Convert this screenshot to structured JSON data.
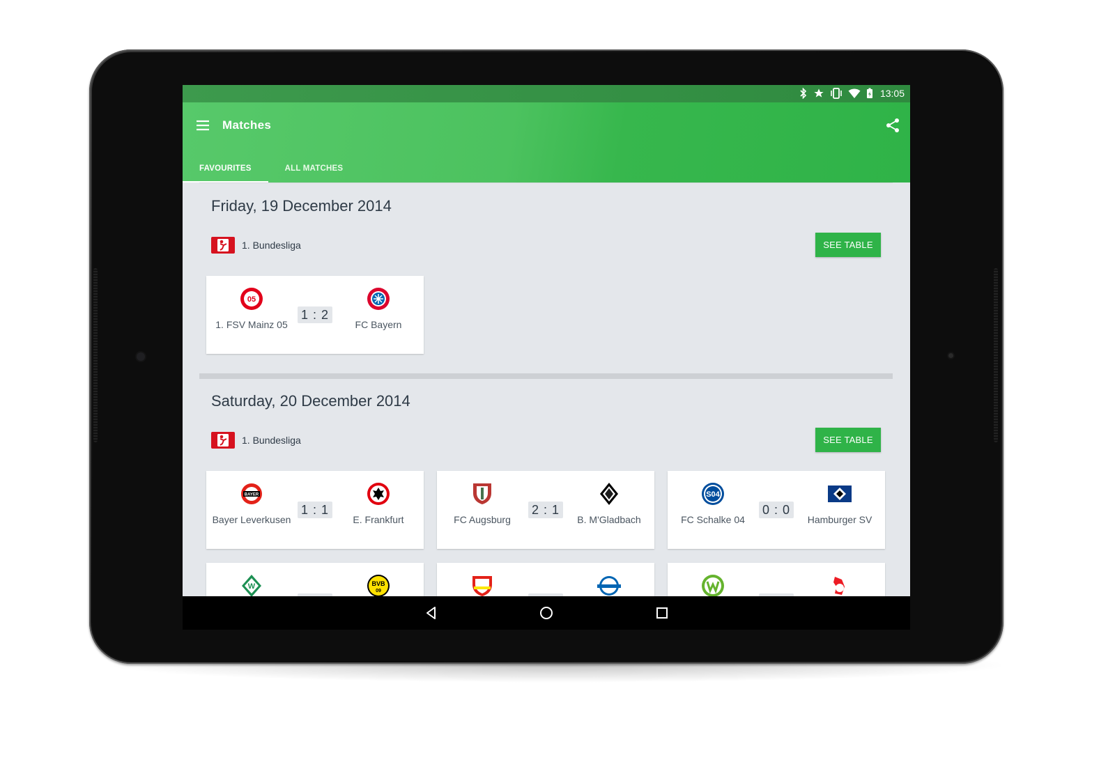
{
  "statusbar": {
    "time": "13:05"
  },
  "appbar": {
    "title": "Matches",
    "tabs": [
      {
        "label": "FAVOURITES",
        "active": true
      },
      {
        "label": "ALL MATCHES",
        "active": false
      }
    ]
  },
  "colors": {
    "primary": "#2fb348",
    "statusbar": "#2f8a3f",
    "background": "#e4e7eb"
  },
  "sections": [
    {
      "date": "Friday, 19 December 2014",
      "league": "1. Bundesliga",
      "see_table": "SEE TABLE",
      "matches": [
        {
          "home": "1. FSV Mainz 05",
          "away": "FC Bayern",
          "score": "1 : 2",
          "home_crest": "mainz-crest",
          "away_crest": "bayern-crest"
        }
      ]
    },
    {
      "date": "Saturday, 20 December 2014",
      "league": "1. Bundesliga",
      "see_table": "SEE TABLE",
      "matches": [
        {
          "home": "Bayer Leverkusen",
          "away": "E. Frankfurt",
          "score": "1 : 1",
          "home_crest": "leverkusen-crest",
          "away_crest": "frankfurt-crest"
        },
        {
          "home": "FC Augsburg",
          "away": "B. M'Gladbach",
          "score": "2 : 1",
          "home_crest": "augsburg-crest",
          "away_crest": "gladbach-crest"
        },
        {
          "home": "FC Schalke 04",
          "away": "Hamburger SV",
          "score": "0 : 0",
          "home_crest": "schalke-crest",
          "away_crest": "hamburg-crest"
        },
        {
          "home": "",
          "away": "",
          "score": "",
          "home_crest": "bremen-crest",
          "away_crest": "dortmund-crest"
        },
        {
          "home": "",
          "away": "",
          "score": "",
          "home_crest": "stuttgart-crest",
          "away_crest": "paderborn-crest"
        },
        {
          "home": "",
          "away": "",
          "score": "",
          "home_crest": "wolfsburg-crest",
          "away_crest": "koeln-crest"
        }
      ]
    }
  ]
}
